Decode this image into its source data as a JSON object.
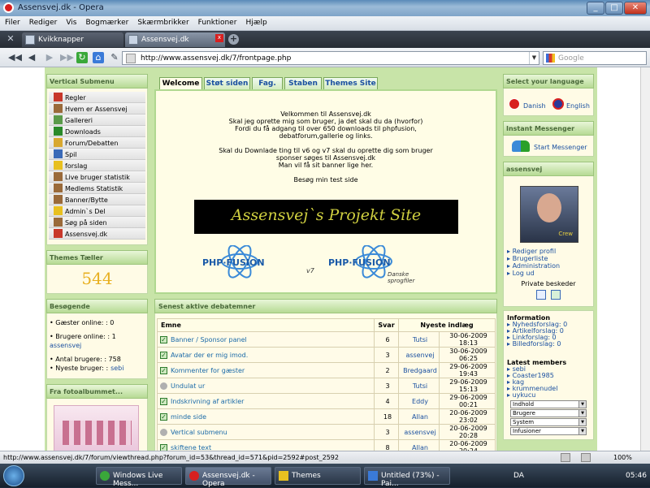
{
  "window": {
    "title": "Assensvej.dk - Opera",
    "min": "_",
    "max": "□",
    "close": "✕"
  },
  "menu": [
    "Filer",
    "Rediger",
    "Vis",
    "Bogmærker",
    "Skærmbrikker",
    "Funktioner",
    "Hjælp"
  ],
  "tabs": [
    {
      "label": "Kvikknapper"
    },
    {
      "label": "Assensvej.dk",
      "close": "x"
    }
  ],
  "new_tab": "+",
  "toolbar": {
    "address": "http://www.assensvej.dk/7/frontpage.php",
    "search_placeholder": "Google"
  },
  "left": {
    "submenu_title": "Vertical Submenu",
    "submenu": [
      {
        "label": "Regler",
        "icon": "house-icon",
        "color": "#c8382a"
      },
      {
        "label": "Hvem er Assensvej",
        "icon": "person-icon",
        "color": "#9a6a3a"
      },
      {
        "label": "Gallereri",
        "icon": "picture-icon",
        "color": "#5a9a4a"
      },
      {
        "label": "Downloads",
        "icon": "check-icon",
        "color": "#2a8a2a"
      },
      {
        "label": "Forum/Debatten",
        "icon": "folder-icon",
        "color": "#d8a830"
      },
      {
        "label": "Spil",
        "icon": "game-icon",
        "color": "#3a6ab8"
      },
      {
        "label": "forslag",
        "icon": "star-icon",
        "color": "#e8c020"
      },
      {
        "label": "Live bruger statistik",
        "icon": "hand-icon",
        "color": "#9a6a3a"
      },
      {
        "label": "Medlems Statistik",
        "icon": "hand-icon",
        "color": "#9a6a3a"
      },
      {
        "label": "Banner/Bytte",
        "icon": "hand-icon",
        "color": "#9a6a3a"
      },
      {
        "label": "Admin`s Del",
        "icon": "warning-icon",
        "color": "#e8c020"
      },
      {
        "label": "Søg på siden",
        "icon": "hand-icon",
        "color": "#9a6a3a"
      },
      {
        "label": "Assensvej.dk",
        "icon": "house-icon",
        "color": "#c8382a"
      }
    ],
    "counter_title": "Themes Tæller",
    "counter_value": "544",
    "visitors_title": "Besøgende",
    "guests": "• Gæster online: : 0",
    "users_online": "• Brugere online: : 1",
    "users_online_name": "assensvej",
    "total_users": "• Antal brugere: : 758",
    "newest_user_label": "• Nyeste bruger: :",
    "newest_user": "sebi",
    "photo_title": "Fra fotoalbummet..."
  },
  "center": {
    "tabs": [
      "Welcome",
      "Støt siden",
      "Fag.",
      "Staben",
      "Themes Site"
    ],
    "welcome_lines": [
      "Velkommen til Assensvej.dk",
      "Skal jeg oprette mig som bruger, ja det skal du da (hvorfor)",
      "Fordi du få adgang til over 650 downloads til phpfusion,",
      "debatforum,gallerie og links.",
      "",
      "Skal du Downlade ting til v6 og v7 skal du oprette dig som bruger",
      "sponser søges til Assensvej.dk",
      "Man vil få sit banner lige her.",
      "",
      "Besøg min test side"
    ],
    "banner_text": "Assensvej`s Projekt Site",
    "logo1_text": "PHP·FUSION",
    "logo1_sub": "v7",
    "logo2_text": "PHP·FUSION",
    "logo2_sub": "Danske sprogfiler",
    "debat_title": "Senest aktive debatemner",
    "debat_cols": [
      "Emne",
      "Svar",
      "Nyeste indlæg"
    ],
    "debat_rows": [
      {
        "topic": "Banner / Sponsor panel",
        "replies": "6",
        "user": "Tutsi",
        "date": "30-06-2009 18:13",
        "icon": "check"
      },
      {
        "topic": "Avatar der er mig imod.",
        "replies": "3",
        "user": "assenvej",
        "date": "30-06-2009 06:25",
        "icon": "check"
      },
      {
        "topic": "Kommenter for gæster",
        "replies": "2",
        "user": "Bredgaard",
        "date": "29-06-2009 19:43",
        "icon": "check"
      },
      {
        "topic": "Undulat ur",
        "replies": "3",
        "user": "Tutsi",
        "date": "29-06-2009 15:13",
        "icon": "grey"
      },
      {
        "topic": "Indskrivning af artikler",
        "replies": "4",
        "user": "Eddy",
        "date": "29-06-2009 00:21",
        "icon": "check"
      },
      {
        "topic": "minde side",
        "replies": "18",
        "user": "Allan",
        "date": "20-06-2009 23:02",
        "icon": "check"
      },
      {
        "topic": "Vertical submenu",
        "replies": "3",
        "user": "assensvej",
        "date": "20-06-2009 20:28",
        "icon": "grey"
      },
      {
        "topic": "skiftene text",
        "replies": "8",
        "user": "Allan",
        "date": "20-06-2009 20:24",
        "icon": "check"
      }
    ]
  },
  "right": {
    "lang_title": "Select your language",
    "lang_da": "Danish",
    "lang_en": "English",
    "im_title": "Instant Messenger",
    "im_start": "Start Messenger",
    "user_title": "assensvej",
    "avatar_label": "Crew",
    "user_links": [
      "Rediger profil",
      "Brugerliste",
      "Administration",
      "Log ud"
    ],
    "pm_label": "Private beskeder",
    "info_title": "Information",
    "info_links": [
      "Nyhedsforslag: 0",
      "Artikelforslag: 0",
      "Linkforslag: 0",
      "Billedforslag: 0"
    ],
    "latest_title": "Latest members",
    "latest": [
      "sebi",
      "Coaster1985",
      "kag",
      "krummenudel",
      "uykucu"
    ],
    "selects": [
      "Indhold",
      "Brugere",
      "System",
      "Infusioner"
    ]
  },
  "status_url": "http://www.assensvej.dk/7/forum/viewthread.php?forum_id=53&thread_id=571&pid=2592#post_2592",
  "zoom": "100%",
  "taskbar": {
    "items": [
      "Windows Live Mess...",
      "Assensvej.dk - Opera",
      "Themes",
      "Untitled (73%) - Pai..."
    ],
    "lang": "DA",
    "time": "05:46"
  }
}
